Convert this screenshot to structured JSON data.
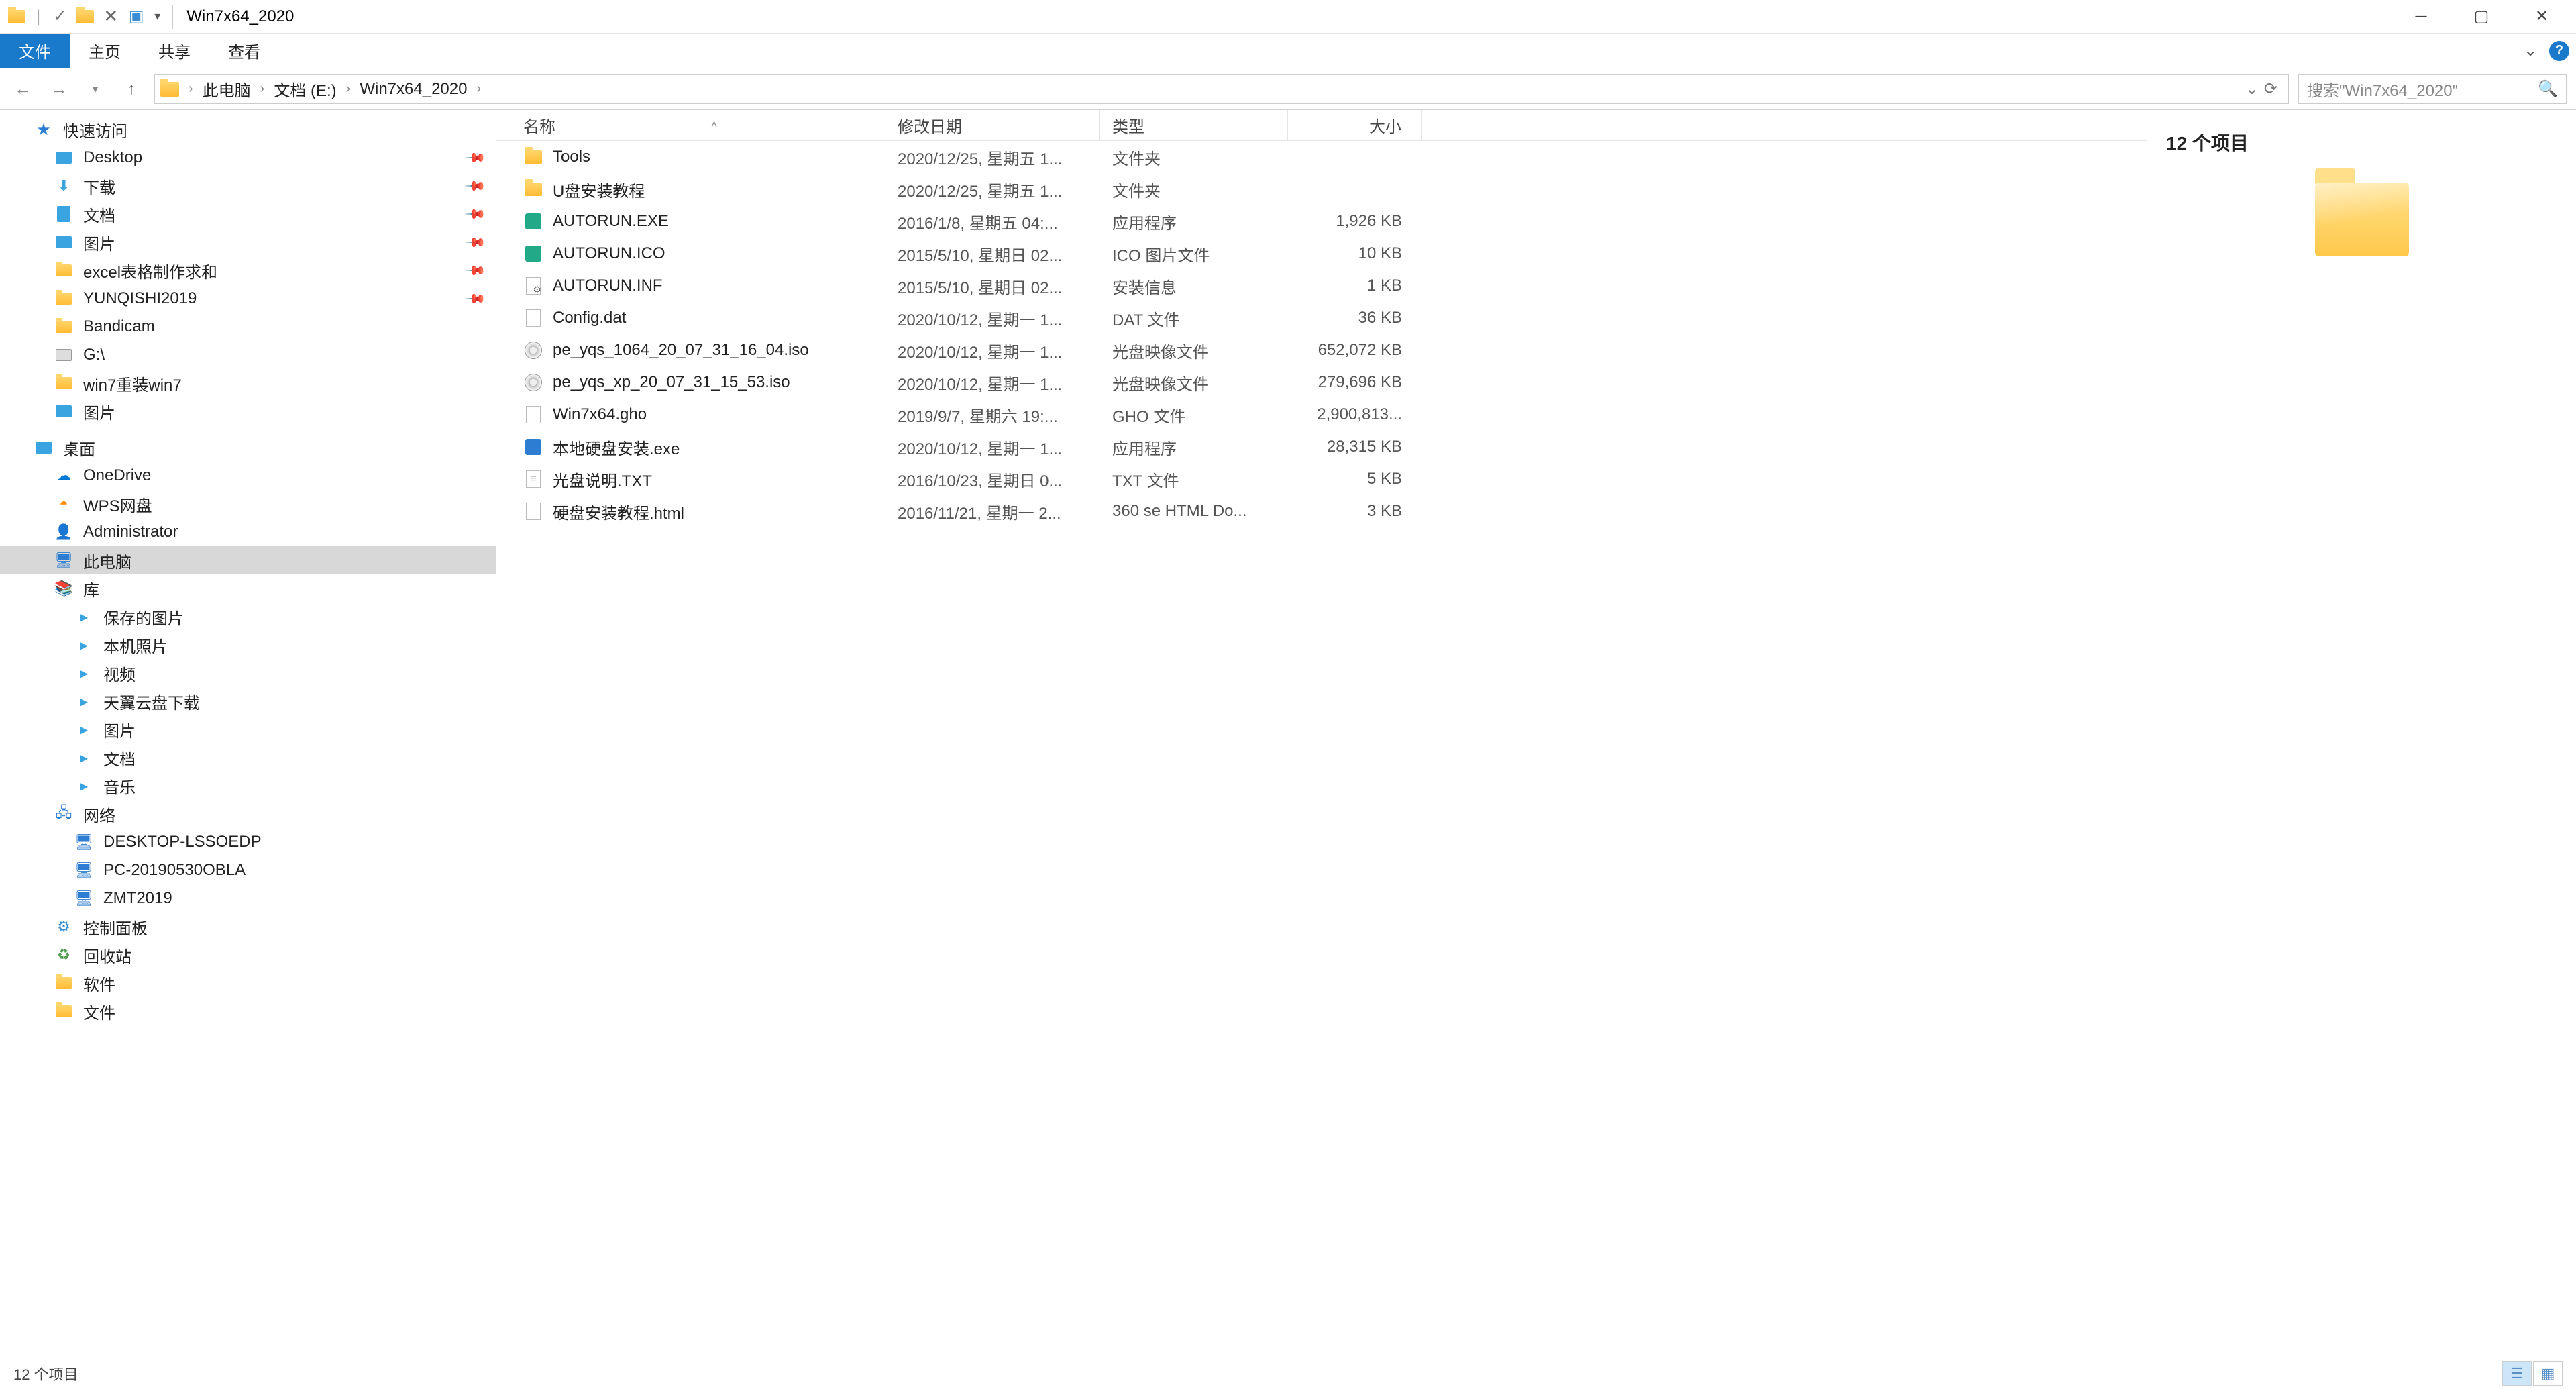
{
  "window": {
    "title": "Win7x64_2020"
  },
  "ribbon": {
    "file": "文件",
    "home": "主页",
    "share": "共享",
    "view": "查看"
  },
  "breadcrumb": {
    "seg0": "此电脑",
    "seg1": "文档 (E:)",
    "seg2": "Win7x64_2020"
  },
  "search": {
    "placeholder": "搜索\"Win7x64_2020\""
  },
  "sidebar": {
    "quickAccess": "快速访问",
    "items": [
      "Desktop",
      "下载",
      "文档",
      "图片",
      "excel表格制作求和",
      "YUNQISHI2019",
      "Bandicam",
      "G:\\",
      "win7重装win7",
      "图片"
    ],
    "desktop": "桌面",
    "oneDrive": "OneDrive",
    "wps": "WPS网盘",
    "admin": "Administrator",
    "thisPC": "此电脑",
    "libraries": "库",
    "libItems": [
      "保存的图片",
      "本机照片",
      "视频",
      "天翼云盘下载",
      "图片",
      "文档",
      "音乐"
    ],
    "network": "网络",
    "netItems": [
      "DESKTOP-LSSOEDP",
      "PC-20190530OBLA",
      "ZMT2019"
    ],
    "controlPanel": "控制面板",
    "recycle": "回收站",
    "software": "软件",
    "files": "文件"
  },
  "columns": {
    "name": "名称",
    "date": "修改日期",
    "type": "类型",
    "size": "大小"
  },
  "files": [
    {
      "name": "Tools",
      "date": "2020/12/25, 星期五 1...",
      "type": "文件夹",
      "size": "",
      "icon": "folder"
    },
    {
      "name": "U盘安装教程",
      "date": "2020/12/25, 星期五 1...",
      "type": "文件夹",
      "size": "",
      "icon": "folder"
    },
    {
      "name": "AUTORUN.EXE",
      "date": "2016/1/8, 星期五 04:...",
      "type": "应用程序",
      "size": "1,926 KB",
      "icon": "exe"
    },
    {
      "name": "AUTORUN.ICO",
      "date": "2015/5/10, 星期日 02...",
      "type": "ICO 图片文件",
      "size": "10 KB",
      "icon": "ico"
    },
    {
      "name": "AUTORUN.INF",
      "date": "2015/5/10, 星期日 02...",
      "type": "安装信息",
      "size": "1 KB",
      "icon": "inf"
    },
    {
      "name": "Config.dat",
      "date": "2020/10/12, 星期一 1...",
      "type": "DAT 文件",
      "size": "36 KB",
      "icon": "file"
    },
    {
      "name": "pe_yqs_1064_20_07_31_16_04.iso",
      "date": "2020/10/12, 星期一 1...",
      "type": "光盘映像文件",
      "size": "652,072 KB",
      "icon": "iso"
    },
    {
      "name": "pe_yqs_xp_20_07_31_15_53.iso",
      "date": "2020/10/12, 星期一 1...",
      "type": "光盘映像文件",
      "size": "279,696 KB",
      "icon": "iso"
    },
    {
      "name": "Win7x64.gho",
      "date": "2019/9/7, 星期六 19:...",
      "type": "GHO 文件",
      "size": "2,900,813...",
      "icon": "gho"
    },
    {
      "name": "本地硬盘安装.exe",
      "date": "2020/10/12, 星期一 1...",
      "type": "应用程序",
      "size": "28,315 KB",
      "icon": "installer"
    },
    {
      "name": "光盘说明.TXT",
      "date": "2016/10/23, 星期日 0...",
      "type": "TXT 文件",
      "size": "5 KB",
      "icon": "txt"
    },
    {
      "name": "硬盘安装教程.html",
      "date": "2016/11/21, 星期一 2...",
      "type": "360 se HTML Do...",
      "size": "3 KB",
      "icon": "html"
    }
  ],
  "preview": {
    "title": "12 个项目"
  },
  "status": {
    "text": "12 个项目"
  }
}
